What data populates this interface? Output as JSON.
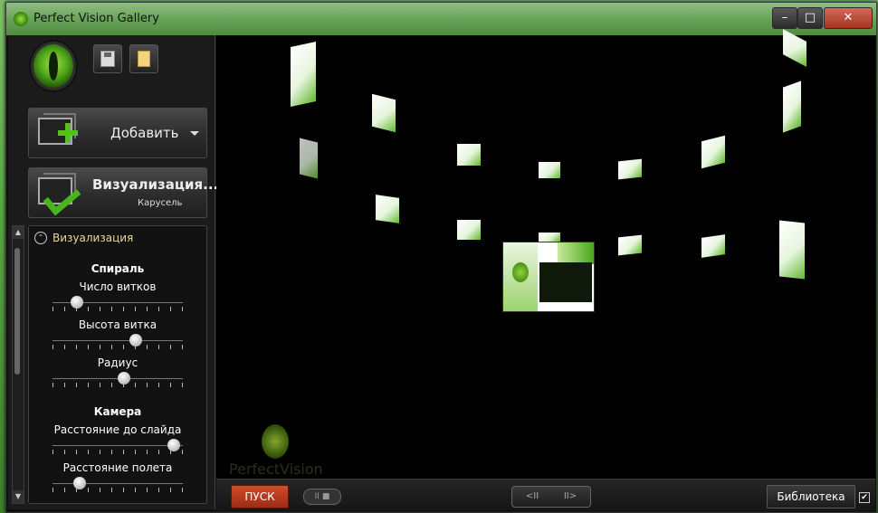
{
  "window": {
    "title": "Perfect Vision Gallery",
    "controls": {
      "minimize": "–",
      "maximize": "□",
      "close": "✕"
    }
  },
  "toolbar": {
    "save_icon": "save-icon",
    "open_icon": "open-file-icon"
  },
  "sidebar": {
    "add_button": {
      "label": "Добавить",
      "icon": "add-image-icon"
    },
    "visualization_button": {
      "label": "Визуализация...",
      "sublabel": "Карусель",
      "icon": "visualization-icon"
    },
    "panel": {
      "title": "Визуализация",
      "sections": [
        {
          "title": "Спираль",
          "sliders": [
            {
              "label": "Число витков",
              "value": 0.15
            },
            {
              "label": "Высота витка",
              "value": 0.65
            },
            {
              "label": "Радиус",
              "value": 0.55
            }
          ]
        },
        {
          "title": "Камера",
          "sliders": [
            {
              "label": "Расстояние до слайда",
              "value": 0.98
            },
            {
              "label": "Расстояние полета",
              "value": 0.18
            }
          ]
        }
      ]
    }
  },
  "viewer": {
    "watermark": "PerfectVision"
  },
  "bottombar": {
    "run_label": "ПУСК",
    "pause_label": "II ■",
    "prev_label": "<II",
    "next_label": "II>",
    "library_label": "Библиотека",
    "library_checked": "✔"
  },
  "colors": {
    "accent_green": "#56c11b",
    "run_red": "#d34b2c",
    "panel_title": "#e8d79a"
  }
}
